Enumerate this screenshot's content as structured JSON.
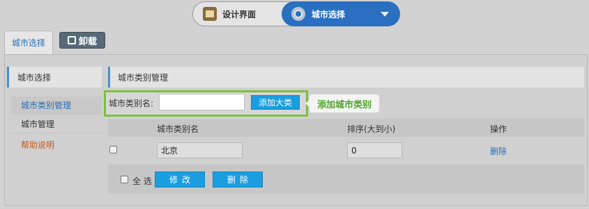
{
  "topbar": {
    "design_label": "设计界面",
    "city_label": "城市选择"
  },
  "tabs": {
    "active_tab": "城市选择",
    "unload_label": "卸载"
  },
  "sidebar": {
    "title": "城市选择",
    "items": [
      {
        "label": "城市类别管理"
      },
      {
        "label": "城市管理"
      },
      {
        "label": "帮助说明"
      }
    ]
  },
  "main": {
    "title": "城市类别管理",
    "form": {
      "label": "城市类别名:",
      "input_value": "",
      "add_button": "添加大类"
    },
    "callout": "添加城市类别",
    "table": {
      "headers": [
        "城市类别名",
        "排序(大到小)",
        "操作"
      ],
      "rows": [
        {
          "name": "北京",
          "order": "0",
          "action": "删除"
        }
      ]
    },
    "footer": {
      "select_all": "全 选",
      "modify_button": "修改",
      "delete_button": "删除"
    }
  },
  "colors": {
    "accent_blue": "#1a9ee0",
    "highlight_green": "#7ec03a",
    "callout_text": "#4fa32a"
  }
}
